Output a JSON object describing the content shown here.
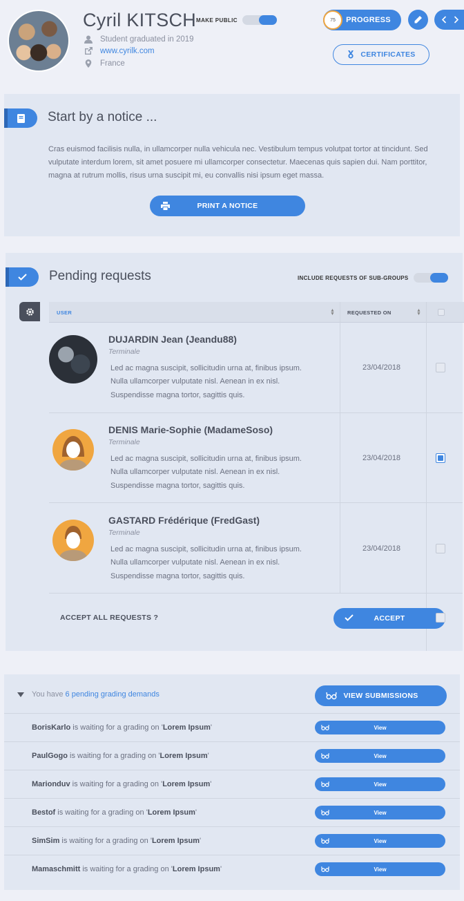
{
  "profile": {
    "name": "Cyril KITSCH",
    "make_public_label": "MAKE PUBLIC",
    "status": "Student graduated in 2019",
    "website": "www.cyrilk.com",
    "location": "France",
    "progress_value": "75",
    "progress_label": "PROGRESS",
    "certificates_label": "CERTIFICATES"
  },
  "notice": {
    "title": "Start by a notice ...",
    "text": "Cras euismod facilisis nulla, in ullamcorper nulla vehicula nec. Vestibulum tempus volutpat tortor at tincidunt. Sed vulputate interdum lorem, sit amet posuere mi ullamcorper consectetur. Maecenas quis sapien dui. Nam porttitor, magna at rutrum mollis, risus urna suscipit mi, eu convallis nisi ipsum eget massa.",
    "print_label": "PRINT A NOTICE"
  },
  "pending": {
    "title": "Pending requests",
    "include_label": "INCLUDE REQUESTS OF SUB-GROUPS",
    "col_user": "USER",
    "col_requested": "REQUESTED ON",
    "rows": [
      {
        "name": "DUJARDIN Jean (Jeandu88)",
        "sub": "Terminale",
        "desc": "Led ac magna suscipit, sollicitudin urna at, finibus ipsum. Nulla ullamcorper vulputate nisl. Aenean in ex nisl. Suspendisse magna tortor, sagittis quis.",
        "date": "23/04/2018",
        "checked": false
      },
      {
        "name": "DENIS Marie-Sophie (MadameSoso)",
        "sub": "Terminale",
        "desc": "Led ac magna suscipit, sollicitudin urna at, finibus ipsum. Nulla ullamcorper vulputate nisl. Aenean in ex nisl. Suspendisse magna tortor, sagittis quis.",
        "date": "23/04/2018",
        "checked": true
      },
      {
        "name": "GASTARD Frédérique (FredGast)",
        "sub": "Terminale",
        "desc": "Led ac magna suscipit, sollicitudin urna at, finibus ipsum. Nulla ullamcorper vulputate nisl. Aenean in ex nisl. Suspendisse magna tortor, sagittis quis.",
        "date": "23/04/2018",
        "checked": false
      }
    ],
    "accept_all_label": "ACCEPT ALL REQUESTS ?",
    "accept_label": "ACCEPT"
  },
  "grading": {
    "intro": "You have ",
    "link": "6 pending grading demands",
    "view_submissions_label": "VIEW SUBMISSIONS",
    "middle": " is waiting for a grading on '",
    "end": "'",
    "view_label": "View",
    "rows": [
      {
        "user": "BorisKarlo",
        "item": "Lorem Ipsum"
      },
      {
        "user": "PaulGogo",
        "item": "Lorem Ipsum"
      },
      {
        "user": "Marionduv",
        "item": "Lorem Ipsum"
      },
      {
        "user": "Bestof",
        "item": "Lorem Ipsum"
      },
      {
        "user": "SimSim",
        "item": "Lorem Ipsum"
      },
      {
        "user": "Mamaschmitt",
        "item": "Lorem Ipsum"
      }
    ]
  },
  "colors": {
    "accent": "#3f86e0",
    "card": "#e1e7f2",
    "background": "#eef0f7"
  },
  "icons": [
    "user-icon",
    "external-link-icon",
    "map-pin-icon",
    "pencil-icon",
    "chevron-left-icon",
    "chevron-right-icon",
    "medal-icon",
    "book-icon",
    "printer-icon",
    "check-icon",
    "gear-icon",
    "glasses-icon",
    "caret-down-icon"
  ]
}
